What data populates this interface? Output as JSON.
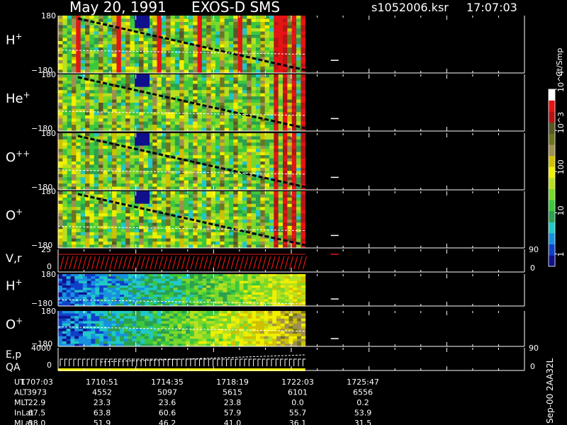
{
  "chart_data": {
    "type": "heatmap",
    "title_date": "May 20, 1991",
    "title_instrument": "EXOS-D SMS",
    "file_name": "s1052006.ksr",
    "file_time": "17:07:03",
    "side_note": "Sep-00 2AA32L",
    "colorbar": {
      "label": "Ct/Smp",
      "scale": "log",
      "range": [
        0.5,
        10000
      ],
      "ticks": [
        "1",
        "10",
        "100",
        "10^3",
        "10^4"
      ],
      "tick_values": [
        1,
        10,
        100,
        1000,
        10000
      ],
      "colors": [
        "#10108c",
        "#1040c8",
        "#1890e0",
        "#20c8c8",
        "#2aa050",
        "#3cc83c",
        "#7ad82a",
        "#b8e020",
        "#f0f000",
        "#d0c000",
        "#a09050",
        "#6e7420",
        "#585828",
        "#b41414",
        "#e61414",
        "#ffffff"
      ]
    },
    "panels": [
      {
        "label": "H",
        "sup": "+",
        "ytick_top": "180",
        "ytick_bottom": "−180",
        "mean_level": 0.4,
        "pitch": false
      },
      {
        "label": "He",
        "sup": "+",
        "ytick_top": "180",
        "ytick_bottom": "−180",
        "mean_level": 0.35,
        "pitch": false
      },
      {
        "label": "O",
        "sup": "++",
        "ytick_top": "180",
        "ytick_bottom": "−180",
        "mean_level": 0.35,
        "pitch": false
      },
      {
        "label": "O",
        "sup": "+",
        "ytick_top": "180",
        "ytick_bottom": "−180",
        "mean_level": 0.38,
        "pitch": false
      },
      {
        "label": "H",
        "sup": "+",
        "ytick_top": "180",
        "ytick_bottom": "−180",
        "mean_level": 0.2,
        "pitch": true
      },
      {
        "label": "O",
        "sup": "+",
        "ytick_top": "180",
        "ytick_bottom": "−180",
        "mean_level": 0.55,
        "pitch": true
      }
    ],
    "vr_panel": {
      "label": "V,r",
      "ytick_top": "25",
      "ytick_bottom": "0",
      "right_top": "90",
      "right_bottom": "0"
    },
    "ep_panel": {
      "label": "E,p",
      "label2": "QA",
      "ytick_top": "4000",
      "ytick_bottom": "0",
      "right_top": "90",
      "right_bottom": "0"
    },
    "data_span_fraction": 0.53,
    "ephemeris": {
      "row_labels": [
        "UT",
        "ALT",
        "MLT",
        "InLat",
        "MLat"
      ],
      "columns": [
        [
          "1707:03",
          "3973",
          "22.9",
          "67.5",
          "58.0"
        ],
        [
          "1710:51",
          "4552",
          "23.3",
          "63.8",
          "51.9"
        ],
        [
          "1714:35",
          "5097",
          "23.6",
          "60.6",
          "46.2"
        ],
        [
          "1718:19",
          "5615",
          "23.8",
          "57.9",
          "41.0"
        ],
        [
          "1722:03",
          "6101",
          "0.0",
          "55.7",
          "36.1"
        ],
        [
          "1725:47",
          "6556",
          "0.2",
          "53.9",
          "31.5"
        ]
      ]
    }
  }
}
